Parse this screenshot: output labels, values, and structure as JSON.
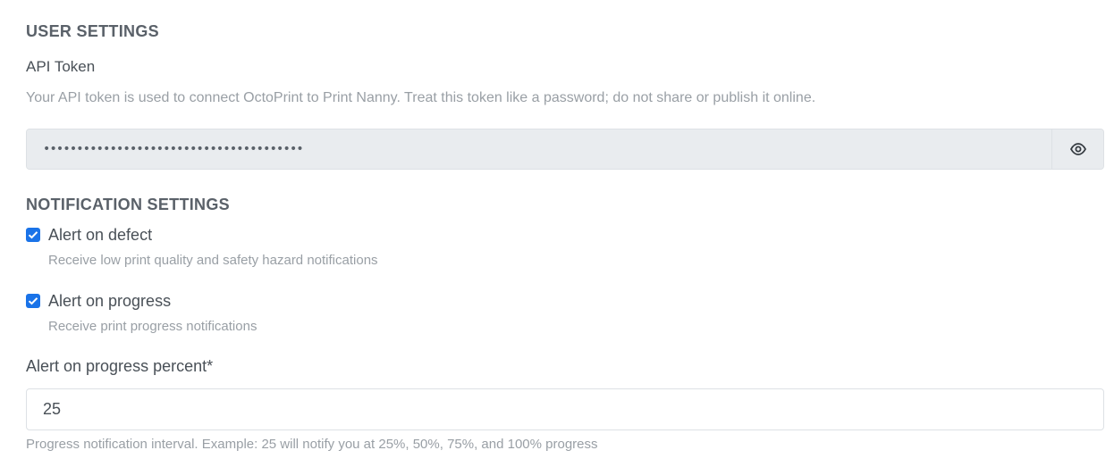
{
  "user_settings": {
    "title": "USER SETTINGS",
    "api_token": {
      "label": "API Token",
      "help": "Your API token is used to connect OctoPrint to Print Nanny. Treat this token like a password; do not share or publish it online.",
      "masked_value": "•••••••••••••••••••••••••••••••••••••••",
      "toggle_icon": "eye-icon"
    }
  },
  "notification_settings": {
    "title": "NOTIFICATION SETTINGS",
    "alert_defect": {
      "label": "Alert on defect",
      "help": "Receive low print quality and safety hazard notifications",
      "checked": true
    },
    "alert_progress": {
      "label": "Alert on progress",
      "help": "Receive print progress notifications",
      "checked": true
    },
    "progress_percent": {
      "label": "Alert on progress percent*",
      "value": "25",
      "help": "Progress notification interval. Example: 25 will notify you at 25%, 50%, 75%, and 100% progress"
    }
  },
  "colors": {
    "checkbox_accent": "#1a73e8",
    "readonly_background": "#e9ecef"
  }
}
